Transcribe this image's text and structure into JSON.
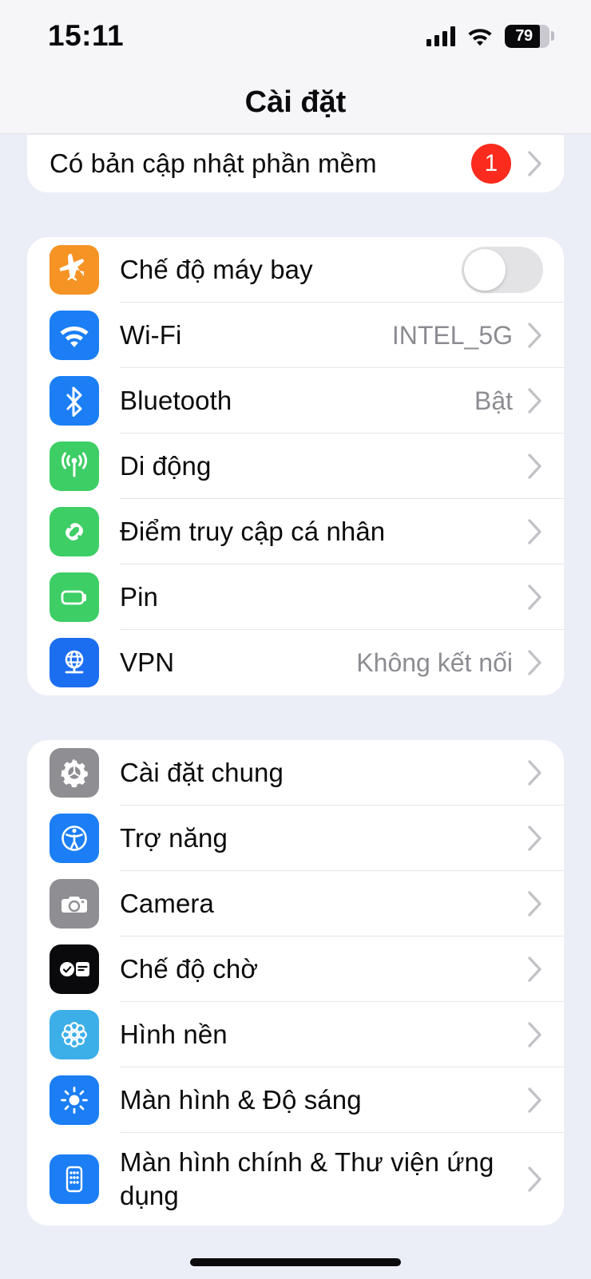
{
  "status_bar": {
    "time": "15:11",
    "signal_icon": "cellular-signal-icon",
    "wifi_icon": "wifi-icon",
    "battery_percent": "79",
    "battery_icon": "battery-icon"
  },
  "nav": {
    "title": "Cài đặt"
  },
  "groups": [
    {
      "id": "software-update",
      "clipped": true,
      "rows": [
        {
          "id": "software-update",
          "label": "Có bản cập nhật phần mềm",
          "badge": "1",
          "icon": null,
          "accessory": "chevron"
        }
      ]
    },
    {
      "id": "connectivity",
      "clipped": false,
      "rows": [
        {
          "id": "airplane-mode",
          "label": "Chế độ máy bay",
          "icon": "airplane-icon",
          "icon_color": "#f59324",
          "accessory": "toggle",
          "toggle_on": false
        },
        {
          "id": "wifi",
          "label": "Wi-Fi",
          "value": "INTEL_5G",
          "icon": "wifi-icon",
          "icon_color": "#1b7ef5",
          "accessory": "chevron"
        },
        {
          "id": "bluetooth",
          "label": "Bluetooth",
          "value": "Bật",
          "icon": "bluetooth-icon",
          "icon_color": "#1b7ef5",
          "accessory": "chevron"
        },
        {
          "id": "cellular",
          "label": "Di động",
          "icon": "cellular-icon",
          "icon_color": "#3dce65",
          "accessory": "chevron"
        },
        {
          "id": "personal-hotspot",
          "label": "Điểm truy cập cá nhân",
          "icon": "hotspot-link-icon",
          "icon_color": "#3dce65",
          "accessory": "chevron"
        },
        {
          "id": "battery",
          "label": "Pin",
          "icon": "battery-icon",
          "icon_color": "#3dce65",
          "accessory": "chevron"
        },
        {
          "id": "vpn",
          "label": "VPN",
          "value": "Không kết nối",
          "icon": "vpn-globe-icon",
          "icon_color": "#1b6ef0",
          "accessory": "chevron"
        }
      ]
    },
    {
      "id": "system",
      "clipped": false,
      "rows": [
        {
          "id": "general",
          "label": "Cài đặt chung",
          "icon": "gear-icon",
          "icon_color": "#8e8e93",
          "accessory": "chevron"
        },
        {
          "id": "accessibility",
          "label": "Trợ năng",
          "icon": "accessibility-icon",
          "icon_color": "#1b7ef5",
          "accessory": "chevron"
        },
        {
          "id": "camera",
          "label": "Camera",
          "icon": "camera-icon",
          "icon_color": "#8e8e93",
          "accessory": "chevron"
        },
        {
          "id": "standby",
          "label": "Chế độ chờ",
          "icon": "standby-clock-icon",
          "icon_color": "#0a0a0d",
          "accessory": "chevron"
        },
        {
          "id": "wallpaper",
          "label": "Hình nền",
          "icon": "wallpaper-flower-icon",
          "icon_color": "#3cafe8",
          "accessory": "chevron"
        },
        {
          "id": "display-brightness",
          "label": "Màn hình & Độ sáng",
          "icon": "brightness-sun-icon",
          "icon_color": "#1b7ef5",
          "accessory": "chevron"
        },
        {
          "id": "home-screen-app-library",
          "label": "Màn hình chính & Thư viện ứng dụng",
          "icon": "home-screen-icon",
          "icon_color": "#1b7ef5",
          "accessory": "chevron",
          "tall": true
        }
      ]
    }
  ],
  "colors": {
    "background": "#eceef7",
    "card": "#ffffff",
    "badge_red": "#fb2b1e",
    "value_gray": "#8c8c92",
    "chevron_gray": "#c2c2c7"
  },
  "home_indicator": "home-indicator"
}
